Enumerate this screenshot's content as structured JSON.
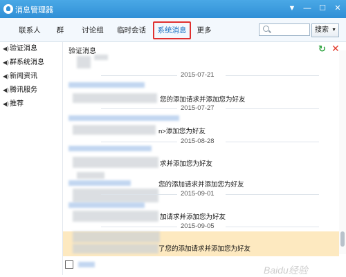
{
  "window": {
    "title": "消息管理器",
    "title_bar_color": "#3d9de0"
  },
  "tabs": [
    {
      "label": "联系人"
    },
    {
      "label": "群"
    },
    {
      "label": "讨论组"
    },
    {
      "label": "临时会话"
    },
    {
      "label": "系统消息",
      "active": true
    },
    {
      "label": "更多"
    }
  ],
  "search": {
    "button_label": "搜索",
    "placeholder": ""
  },
  "sidebar": {
    "items": [
      {
        "label": "验证消息"
      },
      {
        "label": "群系统消息"
      },
      {
        "label": "新闻资讯"
      },
      {
        "label": "腾讯服务"
      },
      {
        "label": "推荐"
      }
    ]
  },
  "pane": {
    "title": "验证消息"
  },
  "dates": [
    "2015-07-21",
    "2015-07-27",
    "2015-08-28",
    "2015-09-01",
    "2015-09-05"
  ],
  "messages": [
    "您的添加请求并添加您为好友",
    "n>添加您为好友",
    "求并添加您为好友",
    "您的添加请求并添加您为好友",
    "加请求并添加您为好友",
    "了您的添加请求并添加您为好友"
  ],
  "watermark": "Baidu经验",
  "colors": {
    "accent": "#1a6fc0",
    "active_tab_border": "#e0302f",
    "highlight_row": "#fde9c0"
  }
}
